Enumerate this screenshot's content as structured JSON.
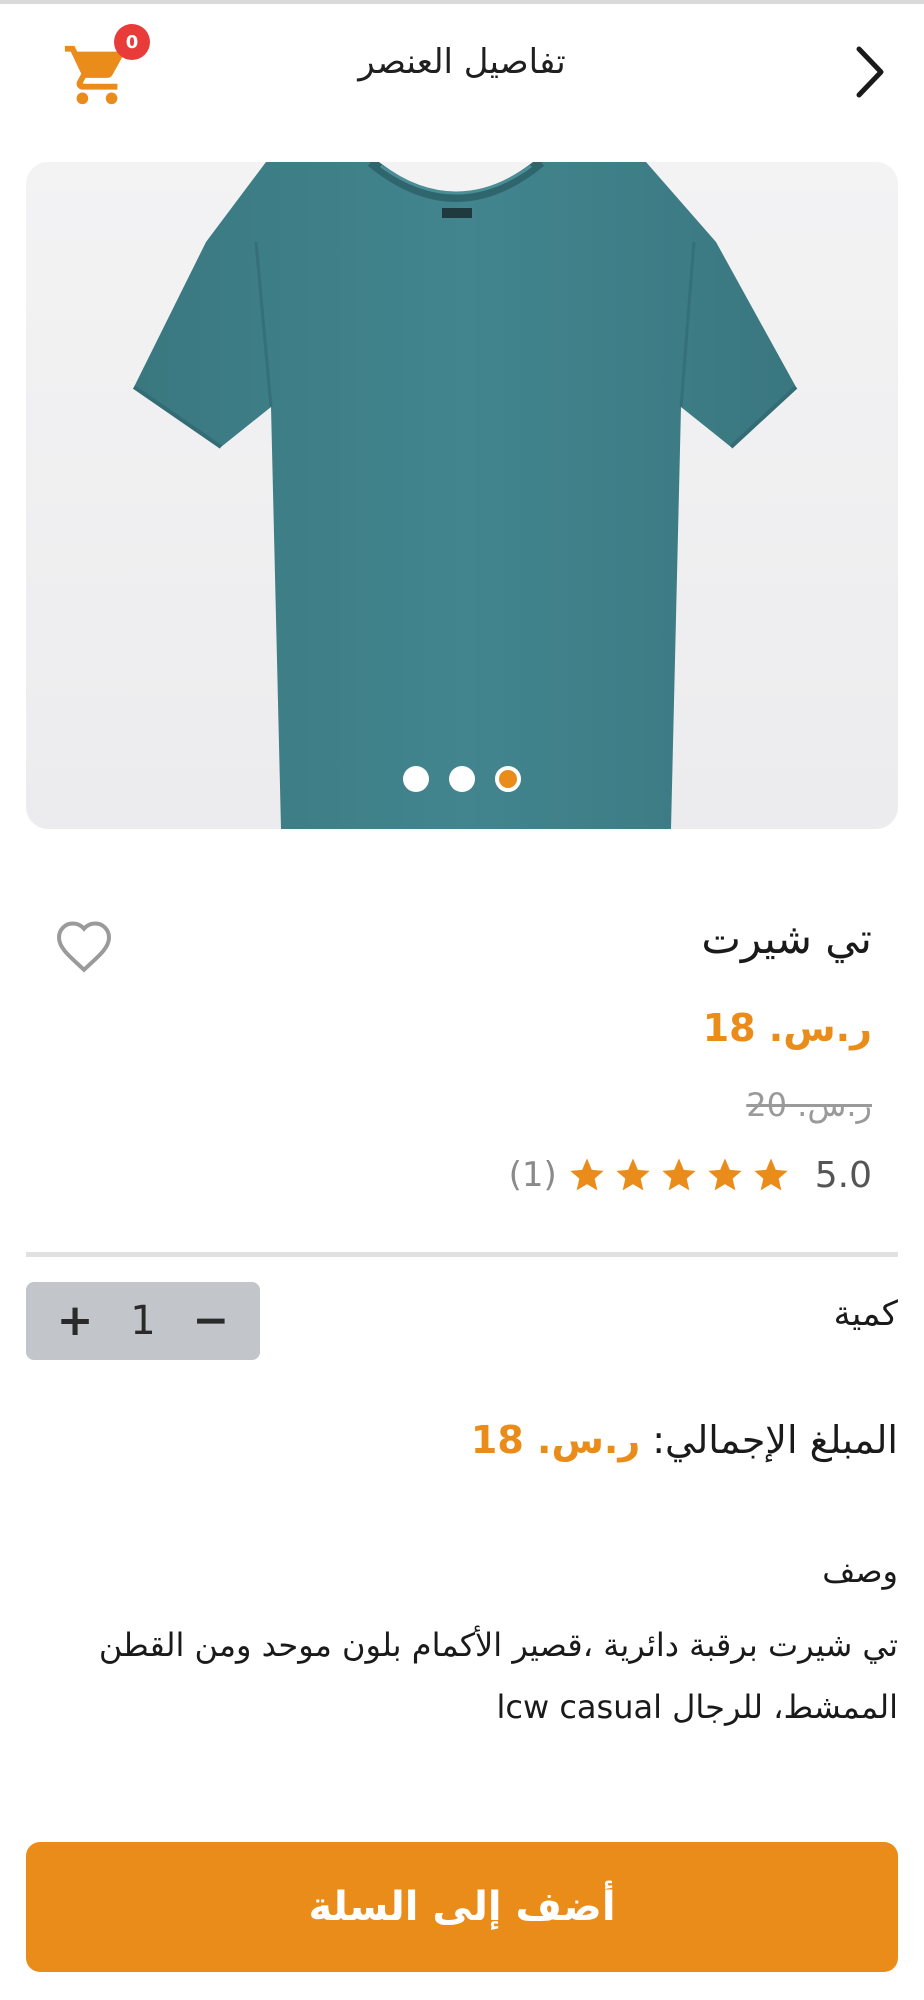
{
  "header": {
    "title": "تفاصيل العنصر",
    "cart_count": "0"
  },
  "product": {
    "name": "تي شيرت",
    "price": "ر.س. 18",
    "old_price": "ر.س. 20",
    "rating": "5.0",
    "stars": 5,
    "rating_count": "(1)",
    "image_colors": {
      "shirt": "#3f7f88",
      "background": "#efeff1"
    },
    "carousel_dots": 3,
    "active_dot": 3
  },
  "quantity": {
    "label": "كمية",
    "value": "1",
    "increment": "+",
    "decrement": "−"
  },
  "total": {
    "label": "المبلغ الإجمالي:",
    "value": "ر.س. 18"
  },
  "description": {
    "title": "وصف",
    "text": "تي شيرت برقبة دائرية ،قصير الأكمام بلون موحد ومن القطن الممشط، للرجال lcw casual"
  },
  "actions": {
    "add_to_cart": "أضف إلى السلة"
  },
  "colors": {
    "accent": "#ea8c1a",
    "badge": "#ea3b3b",
    "stepper_bg": "#c2c6cb"
  }
}
